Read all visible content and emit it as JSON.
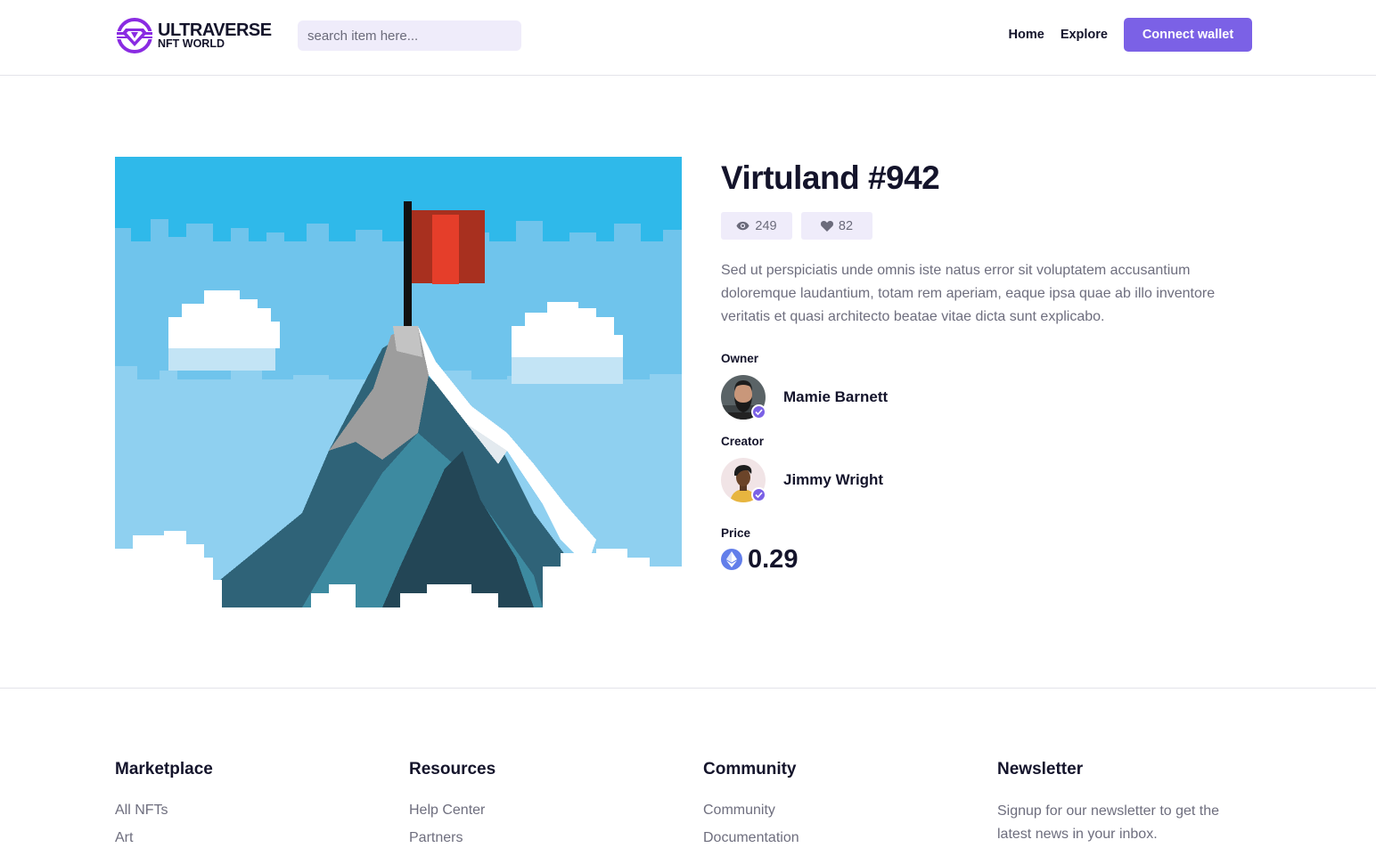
{
  "header": {
    "logo_line1": "ULTRAVERSE",
    "logo_line2": "NFT WORLD",
    "search_placeholder": "search item here...",
    "nav": {
      "home": "Home",
      "explore": "Explore"
    },
    "connect_label": "Connect wallet"
  },
  "item": {
    "title": "Virtuland #942",
    "views": "249",
    "likes": "82",
    "description": "Sed ut perspiciatis unde omnis iste natus error sit voluptatem accusantium doloremque laudantium, totam rem aperiam, eaque ipsa quae ab illo inventore veritatis et quasi architecto beatae vitae dicta sunt explicabo.",
    "owner_label": "Owner",
    "owner_name": "Mamie Barnett",
    "creator_label": "Creator",
    "creator_name": "Jimmy Wright",
    "price_label": "Price",
    "price_value": "0.29",
    "currency_icon": "ethereum-icon"
  },
  "footer": {
    "marketplace": {
      "title": "Marketplace",
      "links": [
        "All NFTs",
        "Art"
      ]
    },
    "resources": {
      "title": "Resources",
      "links": [
        "Help Center",
        "Partners"
      ]
    },
    "community": {
      "title": "Community",
      "links": [
        "Community",
        "Documentation"
      ]
    },
    "newsletter": {
      "title": "Newsletter",
      "text": "Signup for our newsletter to get the latest news in your inbox."
    }
  },
  "colors": {
    "accent": "#7b61e6",
    "accent_soft": "#efecfa",
    "text_dark": "#14142b",
    "text_muted": "#6e6e7e",
    "eth": "#627eea"
  }
}
